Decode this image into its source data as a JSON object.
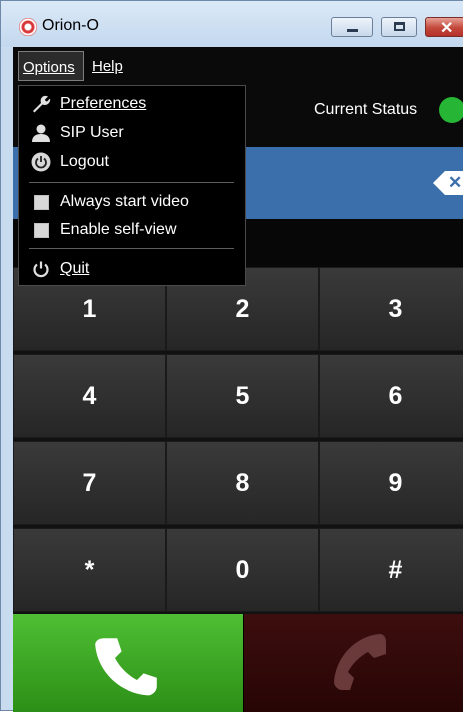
{
  "window": {
    "title": "Orion-O"
  },
  "menubar": {
    "options_label": "Options",
    "help_label": "Help"
  },
  "options_menu": {
    "preferences": "Preferences",
    "sip_user": "SIP User",
    "logout": "Logout",
    "always_start_video": "Always start video",
    "always_start_video_checked": false,
    "enable_self_view": "Enable self-view",
    "enable_self_view_checked": false,
    "quit": "Quit"
  },
  "status": {
    "label": "Current Status",
    "color": "#27b536"
  },
  "number_field": {
    "value": ""
  },
  "keypad": {
    "keys": [
      "1",
      "2",
      "3",
      "4",
      "5",
      "6",
      "7",
      "8",
      "9",
      "*",
      "0",
      "#"
    ]
  },
  "icons": {
    "app": "orion-logo-icon",
    "backspace": "backspace-icon",
    "call": "phone-call-icon",
    "hangup": "phone-hangup-icon",
    "preferences": "wrench-icon",
    "sip_user": "user-icon",
    "logout": "power-icon",
    "quit": "power-icon"
  },
  "colors": {
    "call_green": "#3aa71f",
    "hangup_dark_red": "#320909",
    "number_field_blue": "#3a6fab"
  }
}
